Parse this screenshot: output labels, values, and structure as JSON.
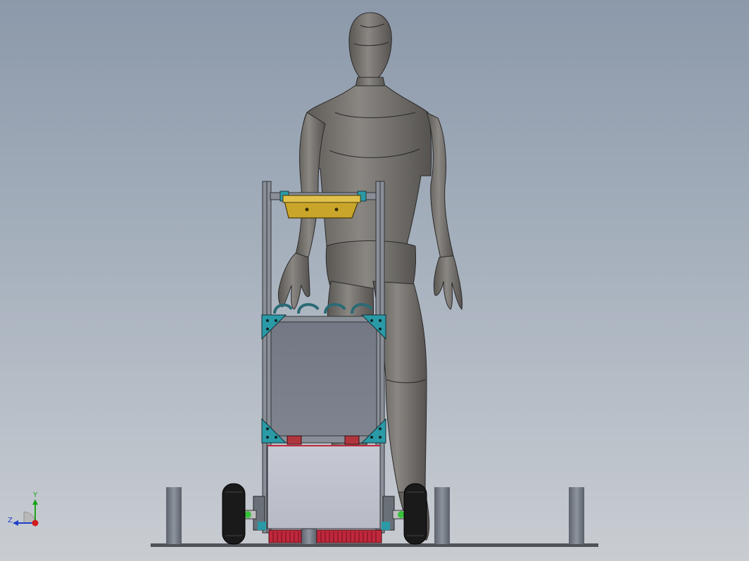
{
  "viewport": {
    "background_top": "#8c99aa",
    "background_bottom": "#c9cdd2"
  },
  "triad": {
    "x_label": "",
    "y_label": "Y",
    "z_label": "Z",
    "x_color": "#d11c1c",
    "y_color": "#1aa31a",
    "z_color": "#1f3fc9"
  },
  "model": {
    "mannequin_color": "#6f6c68",
    "frame_color": "#7d828a",
    "bracket_color": "#2a9aa6",
    "handle_color": "#c9a62a",
    "brush_color": "#c0283c",
    "tire_color": "#1a1a1a",
    "post_color": "#6e747e"
  }
}
